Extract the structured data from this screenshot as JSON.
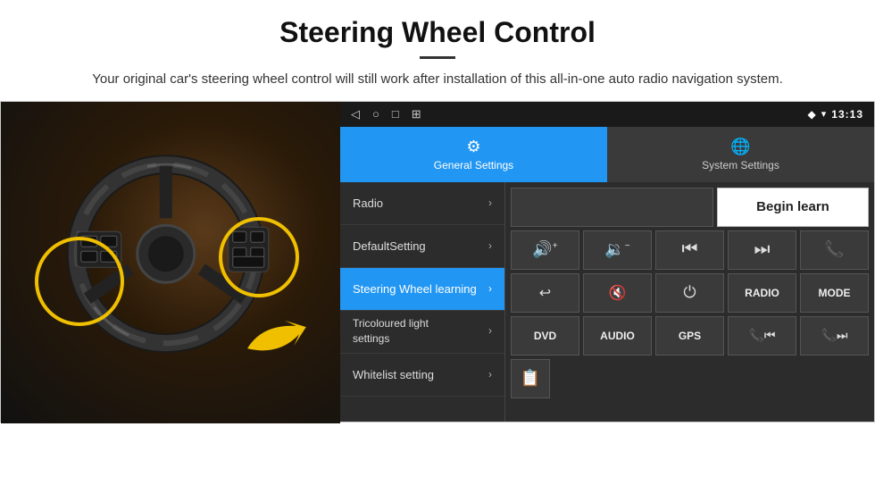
{
  "header": {
    "title": "Steering Wheel Control",
    "subtitle": "Your original car's steering wheel control will still work after installation of this all-in-one auto radio navigation system."
  },
  "statusBar": {
    "navIcons": [
      "◁",
      "○",
      "□",
      "⊞"
    ],
    "rightIcons": [
      "◆",
      "▾"
    ],
    "time": "13:13"
  },
  "tabs": [
    {
      "id": "general",
      "label": "General Settings",
      "icon": "⚙",
      "active": true
    },
    {
      "id": "system",
      "label": "System Settings",
      "icon": "🌐",
      "active": false
    }
  ],
  "menu": [
    {
      "id": "radio",
      "label": "Radio",
      "active": false
    },
    {
      "id": "default",
      "label": "DefaultSetting",
      "active": false
    },
    {
      "id": "steering",
      "label": "Steering Wheel learning",
      "active": true
    },
    {
      "id": "tricoloured",
      "label": "Tricoloured light settings",
      "active": false,
      "twoLine": true
    },
    {
      "id": "whitelist",
      "label": "Whitelist setting",
      "active": false
    }
  ],
  "controls": {
    "beginLearn": "Begin learn",
    "row1": [
      {
        "id": "vol-up",
        "icon": "🔊+",
        "label": "volume-up"
      },
      {
        "id": "vol-down",
        "icon": "🔉−",
        "label": "volume-down"
      },
      {
        "id": "prev-track",
        "icon": "⏮",
        "label": "prev-track"
      },
      {
        "id": "next-track",
        "icon": "⏭",
        "label": "next-track"
      },
      {
        "id": "phone",
        "icon": "📞",
        "label": "phone"
      }
    ],
    "row2": [
      {
        "id": "hang-up",
        "icon": "↩",
        "label": "hang-up"
      },
      {
        "id": "mute",
        "icon": "🔇",
        "label": "mute"
      },
      {
        "id": "power",
        "icon": "⏻",
        "label": "power"
      },
      {
        "id": "radio-btn",
        "text": "RADIO",
        "label": "radio-button"
      },
      {
        "id": "mode-btn",
        "text": "MODE",
        "label": "mode-button"
      }
    ],
    "row3": [
      {
        "id": "dvd-btn",
        "text": "DVD",
        "label": "dvd-button"
      },
      {
        "id": "audio-btn",
        "text": "AUDIO",
        "label": "audio-button"
      },
      {
        "id": "gps-btn",
        "text": "GPS",
        "label": "gps-button"
      },
      {
        "id": "phone-media",
        "icon": "📲⏮",
        "label": "phone-media"
      },
      {
        "id": "phone-skip",
        "icon": "📲⏭",
        "label": "phone-skip"
      }
    ],
    "row4": [
      {
        "id": "list-icon",
        "icon": "📋",
        "label": "list-icon"
      }
    ]
  }
}
